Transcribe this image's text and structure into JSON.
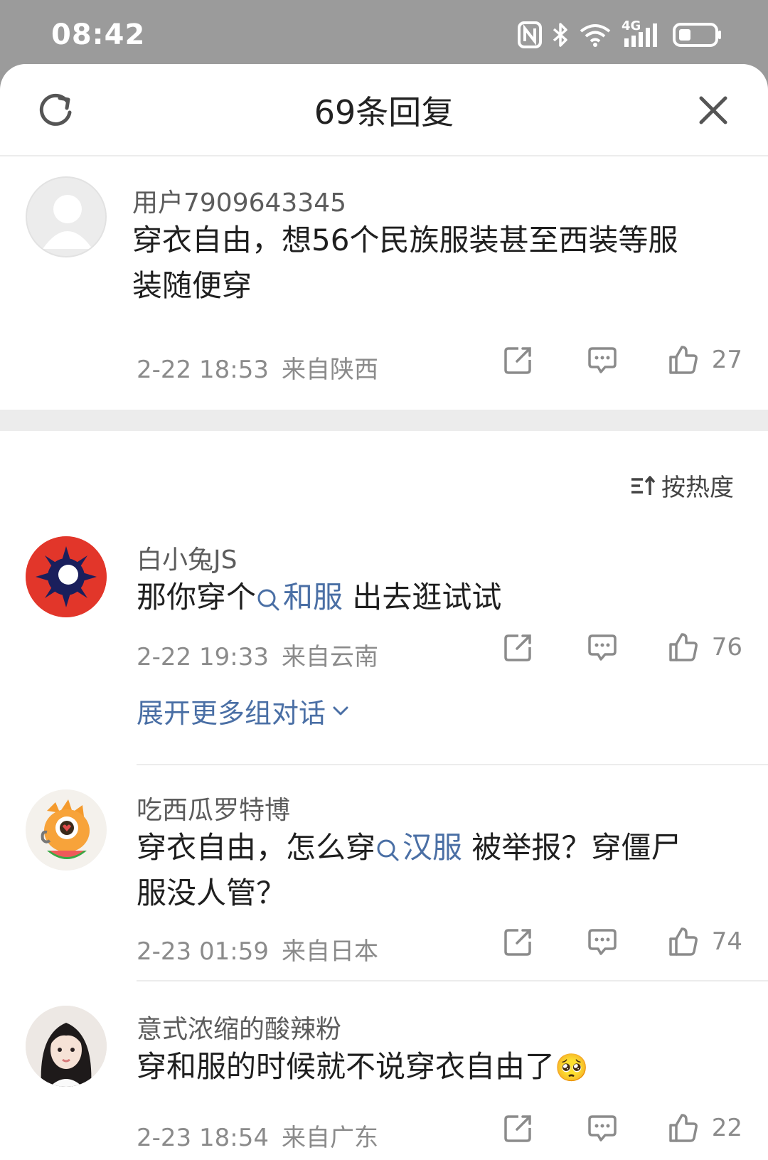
{
  "status_bar": {
    "time": "08:42",
    "network_label": "4G"
  },
  "header": {
    "title": "69条回复"
  },
  "root_comment": {
    "username": "用户7909643345",
    "text_line1": "穿衣自由，想56个民族服装甚至西装等服",
    "text_line2": "装随便穿",
    "time": "2-22 18:53",
    "location": "来自陕西",
    "likes": "27"
  },
  "sort": {
    "label": "按热度"
  },
  "replies": [
    {
      "username": "白小兔JS",
      "text_before": "那你穿个",
      "topic": "和服",
      "text_after": " 出去逛试试",
      "time": "2-22 19:33",
      "location": "来自云南",
      "likes": "76",
      "expand_label": "展开更多组对话"
    },
    {
      "username": "吃西瓜罗特博",
      "text_before": "穿衣自由，怎么穿",
      "topic": "汉服",
      "text_after": " 被举报？穿僵尸",
      "text_line2": "服没人管？",
      "time": "2-23 01:59",
      "location": "来自日本",
      "likes": "74"
    },
    {
      "username": "意式浓缩的酸辣粉",
      "text": "穿和服的时候就不说穿衣自由了",
      "emoji": "🥺",
      "time": "2-23 18:54",
      "location": "来自广东",
      "likes": "22"
    }
  ],
  "colors": {
    "link": "#4a6fa5",
    "meta": "#8b8b8b",
    "status_bar": "#9b9b9b"
  }
}
